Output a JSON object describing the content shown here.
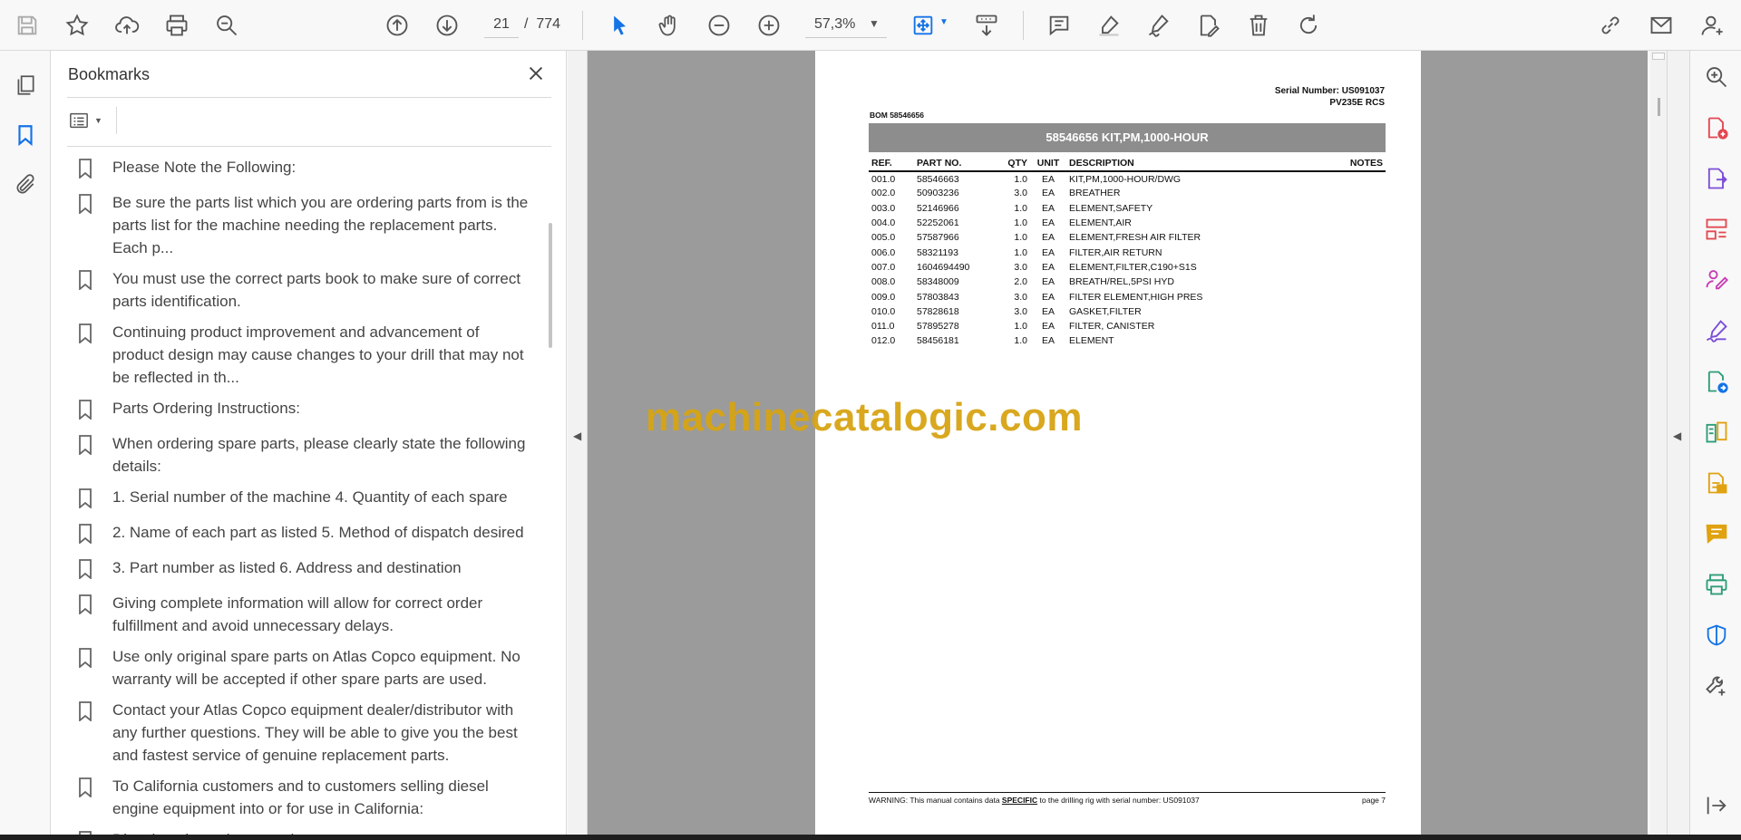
{
  "toolbar": {
    "current_page": "21",
    "page_separator": "/",
    "total_pages": "774",
    "zoom": "57,3%",
    "icons": [
      "save-icon",
      "star-icon",
      "upload-icon",
      "print-icon",
      "zoom-search-icon",
      "page-up-icon",
      "page-down-icon",
      "select-cursor-icon",
      "hand-icon",
      "zoom-out-icon",
      "zoom-in-icon",
      "fit-page-icon",
      "scroll-mode-icon",
      "comment-icon",
      "highlight-icon",
      "sign-icon",
      "edit-pdf-icon",
      "delete-icon",
      "rotate-icon",
      "share-link-icon",
      "email-icon",
      "account-icon"
    ]
  },
  "bookmarks": {
    "title": "Bookmarks",
    "items": [
      {
        "label": "Please Note the Following:"
      },
      {
        "label": "Be sure the parts list which you are ordering parts from is the parts list for the machine needing the replacement parts. Each p..."
      },
      {
        "label": "You must use the correct parts book to make sure of correct parts identification."
      },
      {
        "label": "Continuing product improvement and advancement of product design may cause changes to your drill that may not be reflected in th..."
      },
      {
        "label": "Parts Ordering Instructions:"
      },
      {
        "label": "When ordering spare parts, please clearly state the following details:"
      },
      {
        "label": "1. Serial number of the machine 4. Quantity of each spare"
      },
      {
        "label": "2. Name of each part as listed 5. Method of dispatch desired"
      },
      {
        "label": "3. Part number as listed 6. Address and destination"
      },
      {
        "label": "Giving complete information will allow for correct order fulfillment and avoid unnecessary delays."
      },
      {
        "label": "Use only original spare parts on Atlas Copco equipment. No warranty will be accepted if other spare parts are used."
      },
      {
        "label": "Contact your Atlas Copco equipment dealer/distributor with any further questions. They will be able to give you the best and fastest service of genuine replacement parts."
      },
      {
        "label": "To California customers and to customers selling diesel engine equipment into or for use in California:"
      },
      {
        "label": "Diesel engine exhaust and ..."
      }
    ]
  },
  "document": {
    "serial_line1": "Serial Number: US091037",
    "serial_line2": "PV235E RCS",
    "bom": "BOM 58546656",
    "kit_title": "58546656 KIT,PM,1000-HOUR",
    "columns": {
      "ref": "REF.",
      "part": "PART NO.",
      "qty": "QTY",
      "unit": "UNIT",
      "desc": "DESCRIPTION",
      "notes": "NOTES"
    },
    "rows": [
      {
        "ref": "001.0",
        "part": "58546663",
        "qty": "1.0",
        "unit": "EA",
        "desc": "KIT,PM,1000-HOUR/DWG"
      },
      {
        "ref": "002.0",
        "part": "50903236",
        "qty": "3.0",
        "unit": "EA",
        "desc": "BREATHER"
      },
      {
        "ref": "003.0",
        "part": "52146966",
        "qty": "1.0",
        "unit": "EA",
        "desc": "ELEMENT,SAFETY"
      },
      {
        "ref": "004.0",
        "part": "52252061",
        "qty": "1.0",
        "unit": "EA",
        "desc": "ELEMENT,AIR"
      },
      {
        "ref": "005.0",
        "part": "57587966",
        "qty": "1.0",
        "unit": "EA",
        "desc": "ELEMENT,FRESH AIR FILTER"
      },
      {
        "ref": "006.0",
        "part": "58321193",
        "qty": "1.0",
        "unit": "EA",
        "desc": "FILTER,AIR RETURN"
      },
      {
        "ref": "007.0",
        "part": "1604694490",
        "qty": "3.0",
        "unit": "EA",
        "desc": "ELEMENT,FILTER,C190+S1S"
      },
      {
        "ref": "008.0",
        "part": "58348009",
        "qty": "2.0",
        "unit": "EA",
        "desc": "BREATH/REL,5PSI HYD"
      },
      {
        "ref": "009.0",
        "part": "57803843",
        "qty": "3.0",
        "unit": "EA",
        "desc": "FILTER ELEMENT,HIGH PRES"
      },
      {
        "ref": "010.0",
        "part": "57828618",
        "qty": "3.0",
        "unit": "EA",
        "desc": "GASKET,FILTER"
      },
      {
        "ref": "011.0",
        "part": "57895278",
        "qty": "1.0",
        "unit": "EA",
        "desc": "FILTER, CANISTER"
      },
      {
        "ref": "012.0",
        "part": "58456181",
        "qty": "1.0",
        "unit": "EA",
        "desc": "ELEMENT"
      }
    ],
    "footer_prefix": "WARNING:  This manual contains data ",
    "footer_emph": "SPECIFIC",
    "footer_suffix": " to the drilling rig with serial number: US091037",
    "footer_page": "page 7",
    "watermark": "machinecatalogic.com"
  },
  "colors": {
    "accent_blue": "#1473e6",
    "kit_header_bg": "#8d8d8d",
    "watermark": "#d7a414",
    "tool_red": "#e34850",
    "tool_purple": "#7b4ed8",
    "tool_pink": "#c73ab5",
    "tool_green": "#2d9d78",
    "tool_yellow": "#e0a210"
  },
  "right_tools": [
    "zoom-tool-icon",
    "create-pdf-icon",
    "export-pdf-icon",
    "organize-pages-icon",
    "request-signature-icon",
    "fill-sign-icon",
    "send-review-icon",
    "compare-icon",
    "scan-ocr-icon",
    "comment-tool-icon",
    "print-production-icon",
    "protect-icon",
    "more-tools-icon",
    "expand-panel-icon"
  ]
}
